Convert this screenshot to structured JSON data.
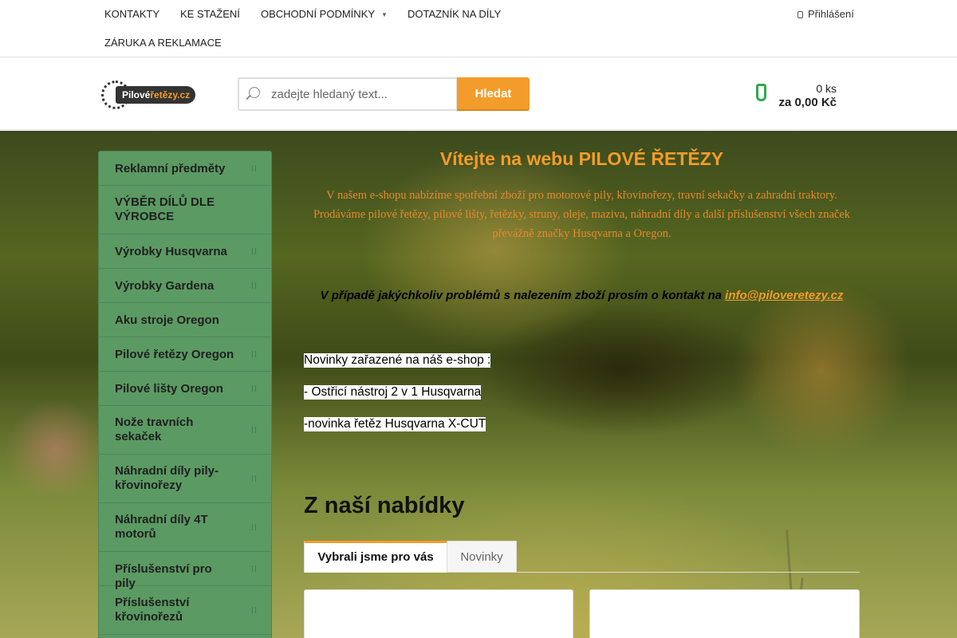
{
  "topnav": {
    "items": [
      "KONTAKTY",
      "KE STAŽENÍ",
      "OBCHODNÍ PODMÍNKY",
      "DOTAZNÍK NA DÍLY",
      "ZÁRUKA A REKLAMACE"
    ],
    "login": "Přihlášení"
  },
  "header": {
    "logo": {
      "word1": "Pilové",
      "word2": "řetězy.cz"
    },
    "search": {
      "placeholder": "zadejte hledaný text...",
      "button": "Hledat"
    },
    "cart": {
      "qty": "0 ks",
      "total": "za 0,00 Kč"
    }
  },
  "sidebar": {
    "items": [
      "Reklamní předměty",
      "VÝBĚR DÍLŮ DLE VÝROBCE",
      "Výrobky Husqvarna",
      "Výrobky Gardena",
      "Aku stroje Oregon",
      "Pilové řetězy Oregon",
      "Pilové lišty Oregon",
      "Nože travních sekaček",
      "Náhradní díly pily-křovinořezy",
      "Náhradní díly 4T motorů",
      "Příslušenství pro pily",
      "Příslušenství křovinořezů"
    ]
  },
  "main": {
    "welcome": "Vítejte na webu PILOVÉ ŘETĚZY",
    "intro": "V našem e-shopu nabízíme spotřební zboží pro motorové pily, křovinořezy, travní sekačky a zahradní traktory. Prodáváme pilové řetězy, pilové lišty, řetězky, struny, oleje, maziva, náhradní díly a další příslušenství všech značek převážně značky Husqvarna a Oregon.",
    "contact_text": "V případě jakýchkoliv problémů s nalezením zboží prosím o kontakt na ",
    "contact_email": "info@piloveretezy.cz",
    "news": [
      "Novinky zařazené na náš e-shop :",
      "- Ostřicí nástroj 2 v 1 Husqvarna",
      "-novinka řetěz Husqvarna X-CUT"
    ],
    "offer_title": "Z naší nabídky",
    "tabs": [
      "Vybrali jsme pro vás",
      "Novinky"
    ]
  },
  "colors": {
    "accent": "#f39c2b",
    "sidebar": "#5b9a63",
    "cart": "#2fa84f"
  }
}
